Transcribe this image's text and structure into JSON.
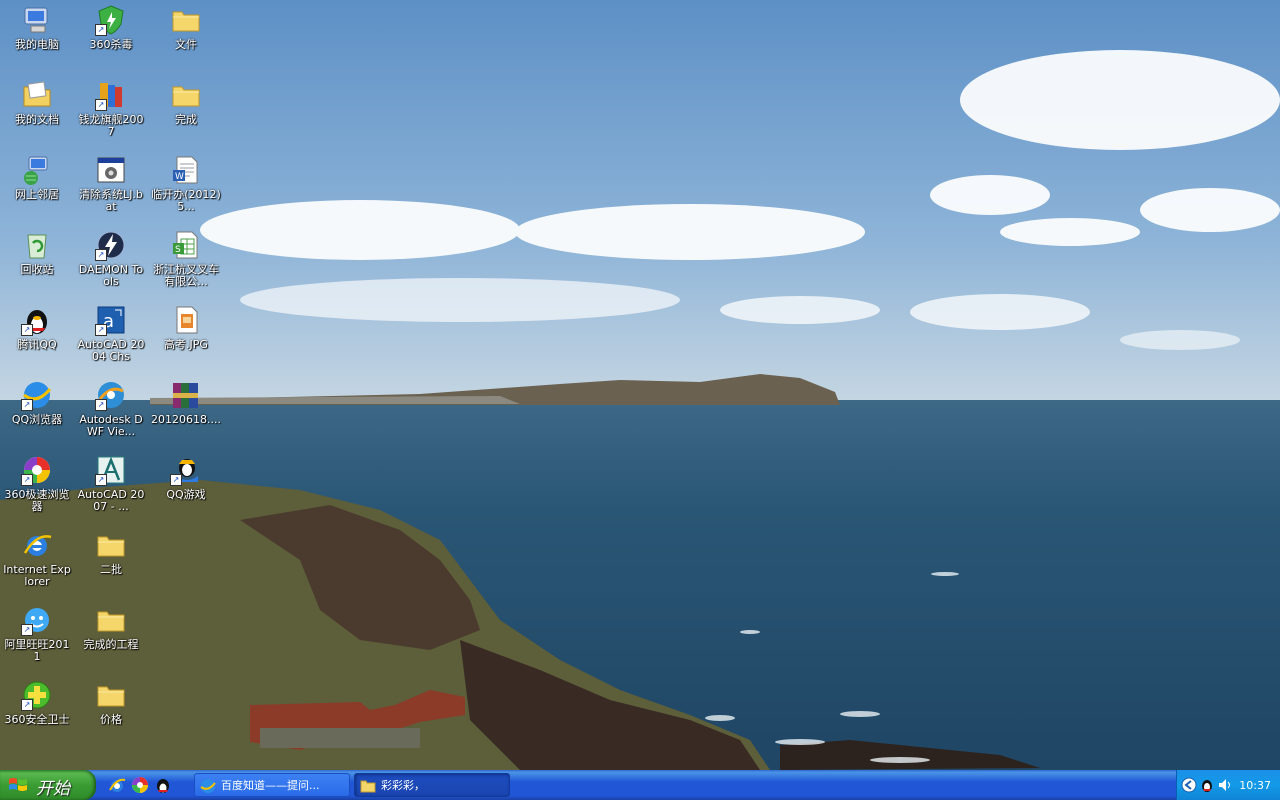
{
  "desktop": {
    "icons": [
      {
        "label": "我的电脑"
      },
      {
        "label": "我的文档"
      },
      {
        "label": "网上邻居"
      },
      {
        "label": "回收站"
      },
      {
        "label": "腾讯QQ"
      },
      {
        "label": "QQ浏览器"
      },
      {
        "label": "360极速浏览器"
      },
      {
        "label": "Internet Explorer"
      },
      {
        "label": "阿里旺旺2011"
      },
      {
        "label": "360安全卫士"
      },
      {
        "label": "360杀毒"
      },
      {
        "label": "钱龙旗舰2007"
      },
      {
        "label": "清除系统LJ.bat"
      },
      {
        "label": "DAEMON Tools"
      },
      {
        "label": "AutoCAD 2004 Chs"
      },
      {
        "label": "Autodesk DWF Vie..."
      },
      {
        "label": "AutoCAD 2007 - ..."
      },
      {
        "label": "二批"
      },
      {
        "label": "完成的工程"
      },
      {
        "label": "价格"
      },
      {
        "label": "文件"
      },
      {
        "label": "完成"
      },
      {
        "label": "临开办(2012)5..."
      },
      {
        "label": "浙江杭叉叉车有限公..."
      },
      {
        "label": "高考.JPG"
      },
      {
        "label": "20120618...."
      },
      {
        "label": "QQ游戏"
      }
    ]
  },
  "taskbar": {
    "start_label": "开始",
    "tasks": [
      {
        "label": "百度知道——提问..."
      },
      {
        "label": "彩彩彩，"
      }
    ],
    "clock": "10:37"
  },
  "colors": {
    "taskbar_blue": "#2157d7",
    "start_green": "#3a9c33",
    "tray_blue": "#129ae8"
  }
}
